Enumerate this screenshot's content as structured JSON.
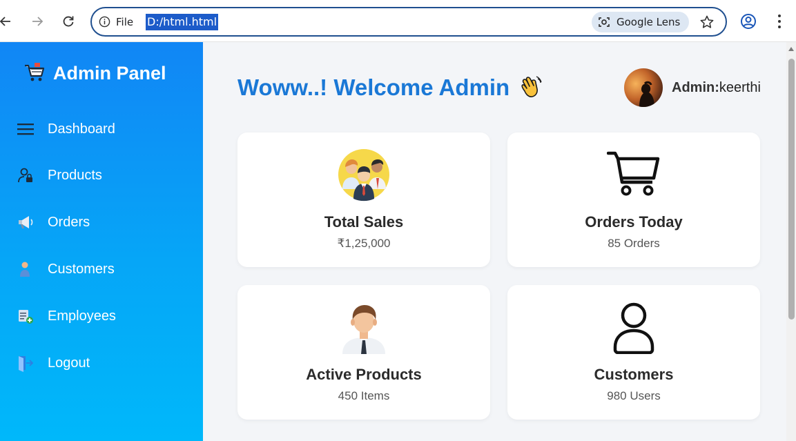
{
  "browser": {
    "back_icon": "arrow-left-icon",
    "forward_icon": "arrow-right-icon",
    "reload_icon": "reload-icon",
    "scheme_label": "File",
    "url": "D:/html.html",
    "lens_label": "Google Lens",
    "bookmark_icon": "star-icon",
    "profile_icon": "profile-icon",
    "menu_icon": "vertical-dots-icon"
  },
  "sidebar": {
    "brand_icon": "shopping-cart-icon",
    "title": "Admin Panel",
    "items": [
      {
        "label": "Dashboard",
        "icon": "hamburger-menu-icon"
      },
      {
        "label": "Products",
        "icon": "user-lock-icon"
      },
      {
        "label": "Orders",
        "icon": "megaphone-icon"
      },
      {
        "label": "Customers",
        "icon": "person-icon"
      },
      {
        "label": "Employees",
        "icon": "add-list-icon"
      },
      {
        "label": "Logout",
        "icon": "logout-door-icon"
      }
    ]
  },
  "header": {
    "welcome": "Woww..! Welcome Admin",
    "wave_icon": "waving-hand-icon",
    "admin_prefix": "Admin:",
    "admin_name": "keerthi"
  },
  "cards": [
    {
      "title": "Total Sales",
      "value": "₹1,25,000",
      "icon": "team-people-icon"
    },
    {
      "title": "Orders Today",
      "value": "85 Orders",
      "icon": "shopping-cart-icon"
    },
    {
      "title": "Active Products",
      "value": "450 Items",
      "icon": "businessman-icon"
    },
    {
      "title": "Customers",
      "value": "980 Users",
      "icon": "user-outline-icon"
    }
  ],
  "colors": {
    "sidebar_top": "#1186f5",
    "sidebar_bottom": "#00b8fa",
    "welcome_text": "#1a78d6",
    "main_background": "#f3f5f8",
    "url_highlight": "#1c5bc9"
  }
}
